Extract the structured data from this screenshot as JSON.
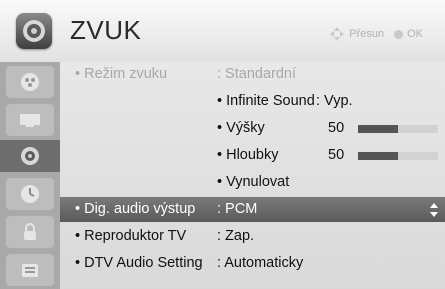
{
  "header": {
    "title": "ZVUK",
    "hint_move": "Přesun",
    "hint_ok": "OK"
  },
  "sidebar": {
    "items": [
      {
        "icon": "picture-icon"
      },
      {
        "icon": "screen-icon"
      },
      {
        "icon": "audio-icon",
        "active": true
      },
      {
        "icon": "clock-icon"
      },
      {
        "icon": "lock-icon"
      },
      {
        "icon": "options-icon"
      }
    ]
  },
  "menu": {
    "sound_mode": {
      "label": "• Režim zvuku",
      "value": ": Standardní",
      "disabled": true
    },
    "infinite_sound": {
      "label": "• Infinite Sound",
      "value": ": Vyp."
    },
    "treble": {
      "label": "• Výšky",
      "value": "50",
      "level": 0.5
    },
    "bass": {
      "label": "• Hloubky",
      "value": "50",
      "level": 0.5
    },
    "reset": {
      "label": "• Vynulovat"
    },
    "digital_audio_out": {
      "label": "• Dig. audio výstup",
      "value": ": PCM",
      "selected": true
    },
    "tv_speaker": {
      "label": "• Reproduktor TV",
      "value": ": Zap."
    },
    "dtv_audio": {
      "label": "• DTV Audio Setting",
      "value": ": Automaticky"
    }
  },
  "colors": {
    "selected_bg": "#6a6a6a",
    "sidebar_bg": "#a9a9a9",
    "disabled_text": "#a8a8a8"
  }
}
